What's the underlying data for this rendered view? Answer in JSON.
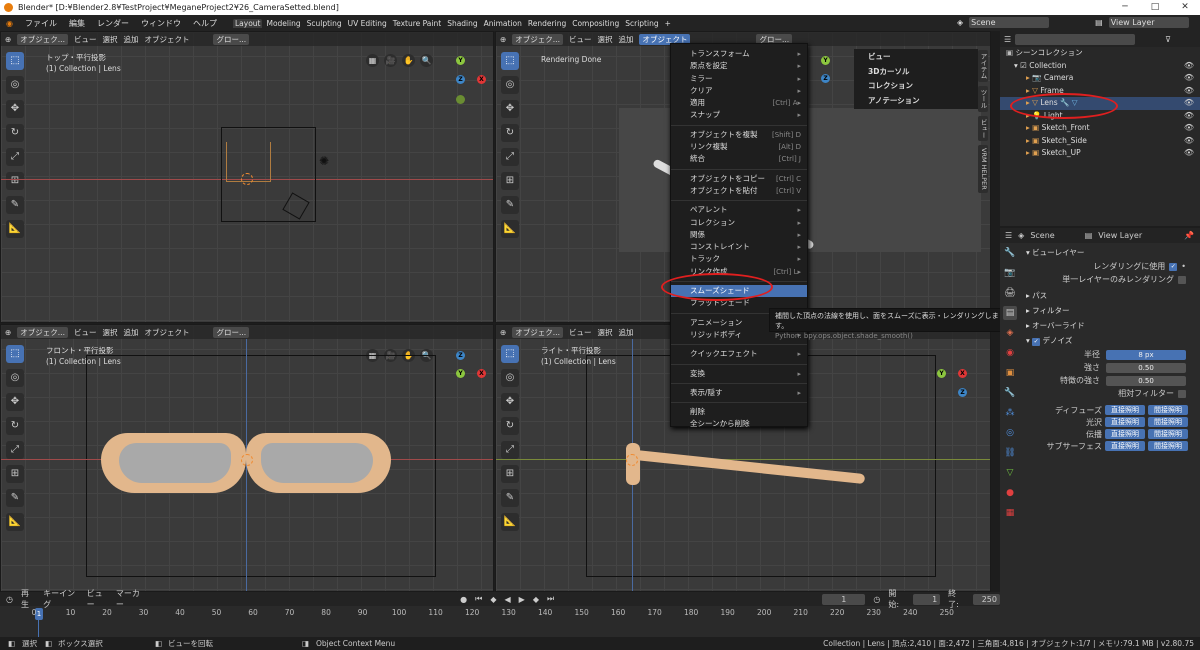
{
  "window": {
    "title": "Blender* [D:¥Blender2.8¥TestProject¥MeganeProject2¥26_CameraSetted.blend]",
    "minimize": "─",
    "maximize": "□",
    "close": "✕"
  },
  "menubar": {
    "items": [
      "ファイル",
      "編集",
      "レンダー",
      "ウィンドウ",
      "ヘルプ"
    ],
    "workspaces": [
      "Layout",
      "Modeling",
      "Sculpting",
      "UV Editing",
      "Texture Paint",
      "Shading",
      "Animation",
      "Rendering",
      "Compositing",
      "Scripting"
    ],
    "scene": "Scene",
    "view_layer": "View Layer"
  },
  "viewport": {
    "header_mode": "オブジェク...",
    "header_menus": [
      "ビュー",
      "選択",
      "追加",
      "オブジェクト"
    ],
    "transform": "グロー...",
    "top_label": [
      "トップ・平行投影",
      "(1) Collection | Lens"
    ],
    "front_label": [
      "フロント・平行投影",
      "(1) Collection | Lens"
    ],
    "right_label": [
      "ライト・平行投影",
      "(1) Collection | Lens"
    ],
    "render_label": "Rendering Done",
    "axis": {
      "x": "X",
      "y": "Y",
      "z": "Z"
    }
  },
  "context_menu": {
    "items": [
      {
        "label": "トランスフォーム",
        "shortcut": "▸"
      },
      {
        "label": "原点を設定",
        "shortcut": "▸"
      },
      {
        "label": "ミラー",
        "shortcut": "▸"
      },
      {
        "label": "クリア",
        "shortcut": "▸"
      },
      {
        "label": "適用",
        "shortcut": "[Ctrl] A▸"
      },
      {
        "label": "スナップ",
        "shortcut": "▸"
      },
      {
        "label": "オブジェクトを複製",
        "shortcut": "[Shift] D"
      },
      {
        "label": "リンク複製",
        "shortcut": "[Alt] D"
      },
      {
        "label": "統合",
        "shortcut": "[Ctrl] J"
      },
      {
        "label": "オブジェクトをコピー",
        "shortcut": "[Ctrl] C"
      },
      {
        "label": "オブジェクトを貼付",
        "shortcut": "[Ctrl] V"
      },
      {
        "label": "ペアレント",
        "shortcut": "▸"
      },
      {
        "label": "コレクション",
        "shortcut": "▸"
      },
      {
        "label": "関係",
        "shortcut": "▸"
      },
      {
        "label": "コンストレイント",
        "shortcut": "▸"
      },
      {
        "label": "トラック",
        "shortcut": "▸"
      },
      {
        "label": "リンク作成",
        "shortcut": "[Ctrl] L▸"
      },
      {
        "label": "スムーズシェード",
        "shortcut": ""
      },
      {
        "label": "フラットシェード",
        "shortcut": ""
      },
      {
        "label": "アニメーション",
        "shortcut": "▸"
      },
      {
        "label": "リジッドボディ",
        "shortcut": "▸"
      },
      {
        "label": "クイックエフェクト",
        "shortcut": "▸"
      },
      {
        "label": "変換",
        "shortcut": "▸"
      },
      {
        "label": "表示/隠す",
        "shortcut": "▸"
      },
      {
        "label": "削除",
        "shortcut": ""
      },
      {
        "label": "全シーンから削除",
        "shortcut": ""
      }
    ]
  },
  "submenu": {
    "items": [
      "ビュー",
      "3Dカーソル",
      "コレクション",
      "アノテーション"
    ]
  },
  "tooltip": {
    "text": "補間した頂点の法線を使用し、面をスムーズに表示・レンダリングします。",
    "python": "Python: bpy.ops.object.shade_smooth()"
  },
  "sidebar_tabs": [
    "アイテム",
    "ツール",
    "ビュー",
    "VRM HELPER"
  ],
  "outliner": {
    "root": "シーンコレクション",
    "collection": "Collection",
    "items": [
      "Camera",
      "Frame",
      "Lens",
      "Light",
      "Sketch_Front",
      "Sketch_Side",
      "Sketch_UP"
    ]
  },
  "properties": {
    "scene": "Scene",
    "view_layer": "View Layer",
    "section_view_layer": "ビューレイヤー",
    "use_for_render": "レンダリングに使用",
    "single_layer": "単一レイヤーのみレンダリング",
    "sections": [
      "パス",
      "フィルター",
      "オーバーライド",
      "デノイズ"
    ],
    "radius_label": "半径",
    "radius_value": "8 px",
    "strength_label": "強さ",
    "strength_value": "0.50",
    "feature_label": "特徴の強さ",
    "feature_value": "0.50",
    "relative_filter": "相対フィルター",
    "passes": [
      {
        "label": "ディフューズ",
        "a": "直接照明",
        "b": "間接照明"
      },
      {
        "label": "光沢",
        "a": "直接照明",
        "b": "間接照明"
      },
      {
        "label": "伝播",
        "a": "直接照明",
        "b": "間接照明"
      },
      {
        "label": "サブサーフェス",
        "a": "直接照明",
        "b": "間接照明"
      }
    ]
  },
  "timeline": {
    "menus": [
      "再生",
      "キーイング",
      "ビュー",
      "マーカー"
    ],
    "current_frame": "1",
    "start_label": "開始:",
    "start": "1",
    "end_label": "終了:",
    "end": "250",
    "ticks": [
      0,
      10,
      20,
      30,
      40,
      50,
      60,
      70,
      80,
      90,
      100,
      110,
      120,
      130,
      140,
      150,
      160,
      170,
      180,
      190,
      200,
      210,
      220,
      230,
      240,
      250
    ],
    "playhead": "1"
  },
  "statusbar": {
    "select": "選択",
    "box_select": "ボックス選択",
    "rotate_view": "ビューを回転",
    "context_menu": "Object Context Menu",
    "stats": "Collection | Lens | 頂点:2,410 | 面:2,472 | 三角面:4,816 | オブジェクト:1/7 | メモリ:79.1 MB | v2.80.75"
  }
}
